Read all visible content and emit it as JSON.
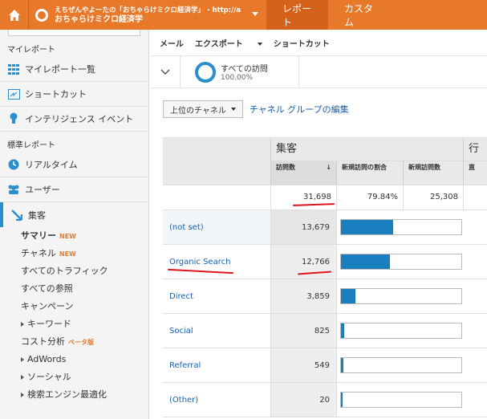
{
  "topbar": {
    "account_line1": "えちぜんやよーたの「おちゃらけミクロ経済学」 - http://acade...",
    "account_line2": "おちゃらけミクロ経済学",
    "tab_report": "レポート",
    "tab_custom": "カスタム",
    "colors": {
      "bar": "#e8792b",
      "active": "#d4621a"
    }
  },
  "sidebar": {
    "my_report_heading": "マイレポート",
    "my_items": [
      {
        "label": "マイレポート一覧",
        "icon": "grid-icon"
      },
      {
        "label": "ショートカット",
        "icon": "shortcut-icon"
      },
      {
        "label": "インテリジェンス イベント",
        "icon": "lightbulb-icon"
      }
    ],
    "std_report_heading": "標準レポート",
    "std_items": [
      {
        "label": "リアルタイム",
        "icon": "clock-icon"
      },
      {
        "label": "ユーザー",
        "icon": "users-icon"
      },
      {
        "label": "集客",
        "icon": "acquisition-icon"
      }
    ],
    "sub_items": [
      {
        "label": "サマリー",
        "badge": "NEW"
      },
      {
        "label": "チャネル",
        "badge": "NEW"
      },
      {
        "label": "すべてのトラフィック",
        "badge": ""
      },
      {
        "label": "すべての参照",
        "badge": ""
      },
      {
        "label": "キャンペーン",
        "badge": ""
      },
      {
        "label": "キーワード",
        "badge": ""
      },
      {
        "label": "コスト分析",
        "badge": "ベータ版"
      },
      {
        "label": "AdWords",
        "badge": ""
      },
      {
        "label": "ソーシャル",
        "badge": ""
      },
      {
        "label": "検索エンジン最適化",
        "badge": ""
      }
    ]
  },
  "main": {
    "toolbar": {
      "mail": "メール",
      "export": "エクスポート",
      "shortcut": "ショートカット"
    },
    "segment": {
      "title": "すべての訪問",
      "pct": "100.00%"
    },
    "dimension_select": "上位のチャネル",
    "edit_link": "チャネル グループの編集",
    "table": {
      "group_header": "集客",
      "group_header2": "行",
      "col_headers": [
        "訪問数",
        "新規訪問の割合",
        "新規訪問数",
        "直"
      ],
      "totals": {
        "visits": "31,698",
        "new_pct": "79.84%",
        "new_visits": "25,308"
      },
      "rows": [
        {
          "name": "(not set)",
          "visits": "13,679",
          "share": 0.4315
        },
        {
          "name": "Organic Search",
          "visits": "12,766",
          "share": 0.4027
        },
        {
          "name": "Direct",
          "visits": "3,859",
          "share": 0.1217
        },
        {
          "name": "Social",
          "visits": "825",
          "share": 0.026
        },
        {
          "name": "Referral",
          "visits": "549",
          "share": 0.0173
        },
        {
          "name": "(Other)",
          "visits": "20",
          "share": 0.0006
        }
      ]
    }
  }
}
